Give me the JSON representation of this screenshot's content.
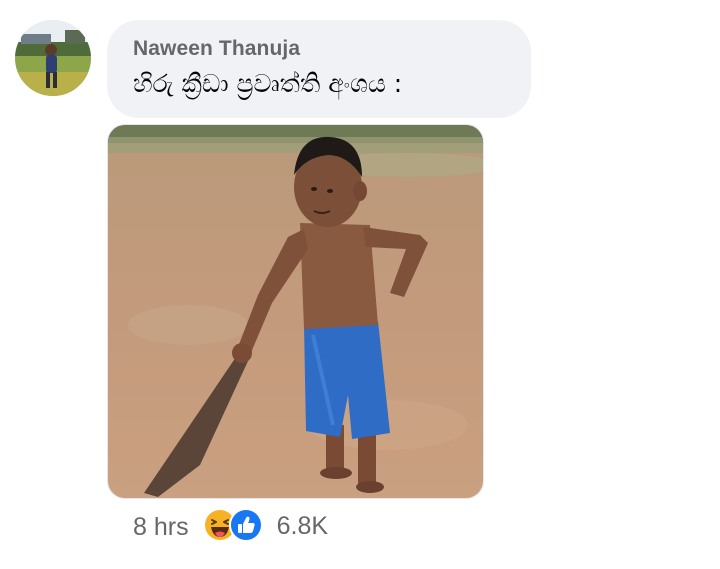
{
  "comment": {
    "author": "Naween Thanuja",
    "text": "හිරු ක්‍රීඩා ප්‍රවෘත්ති අංශය :",
    "timestamp": "8 hrs",
    "reactions": {
      "types": [
        "haha-icon",
        "like-icon"
      ],
      "count": "6.8K"
    }
  },
  "colors": {
    "bubble": "#f0f2f5",
    "author": "#65676b",
    "text": "#050505",
    "meta": "#65676b",
    "like": "#1877f2",
    "haha": "#f7b125"
  }
}
